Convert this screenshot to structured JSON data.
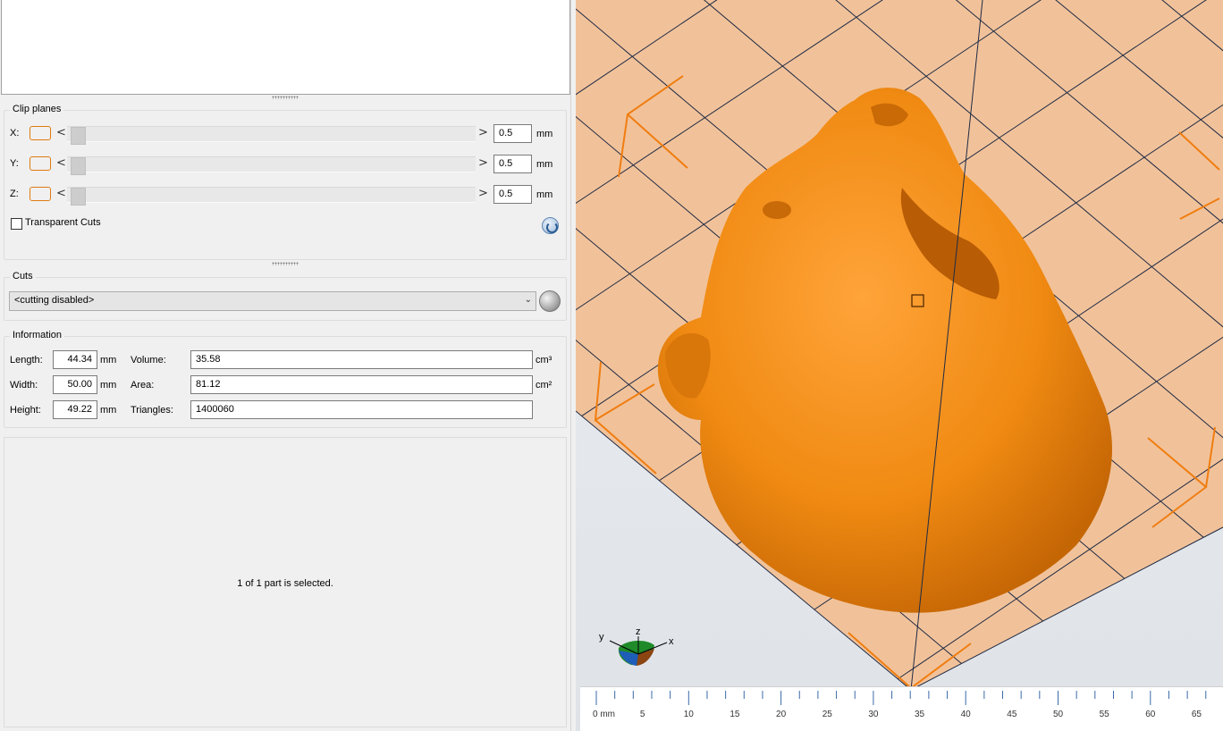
{
  "clip_planes": {
    "title": "Clip planes",
    "rows": [
      {
        "axis": "X:",
        "value": "0.5",
        "unit": "mm"
      },
      {
        "axis": "Y:",
        "value": "0.5",
        "unit": "mm"
      },
      {
        "axis": "Z:",
        "value": "0.5",
        "unit": "mm"
      }
    ],
    "arrow_left": "<",
    "arrow_right": ">",
    "transparent_cuts_label": "Transparent Cuts",
    "transparent_cuts_checked": false
  },
  "cuts": {
    "title": "Cuts",
    "selected": "<cutting disabled>"
  },
  "information": {
    "title": "Information",
    "length_label": "Length:",
    "length_value": "44.34",
    "length_unit": "mm",
    "width_label": "Width:",
    "width_value": "50.00",
    "width_unit": "mm",
    "height_label": "Height:",
    "height_value": "49.22",
    "height_unit": "mm",
    "volume_label": "Volume:",
    "volume_value": "35.58",
    "volume_unit": "cm³",
    "area_label": "Area:",
    "area_value": "81.12",
    "area_unit": "cm²",
    "triangles_label": "Triangles:",
    "triangles_value": "1400060"
  },
  "selection": {
    "status": "1 of 1 part is selected."
  },
  "viewport": {
    "axis_labels": {
      "x": "x",
      "y": "y",
      "z": "z"
    },
    "model_color": "#f08a12",
    "bed_color": "#f1c29a",
    "grid_color": "#1f2a44",
    "bracket_color": "#f07d10"
  },
  "ruler": {
    "labels": [
      "0 mm",
      "5",
      "10",
      "15",
      "20",
      "25",
      "30",
      "35",
      "40",
      "45",
      "50",
      "55",
      "60",
      "65"
    ]
  }
}
